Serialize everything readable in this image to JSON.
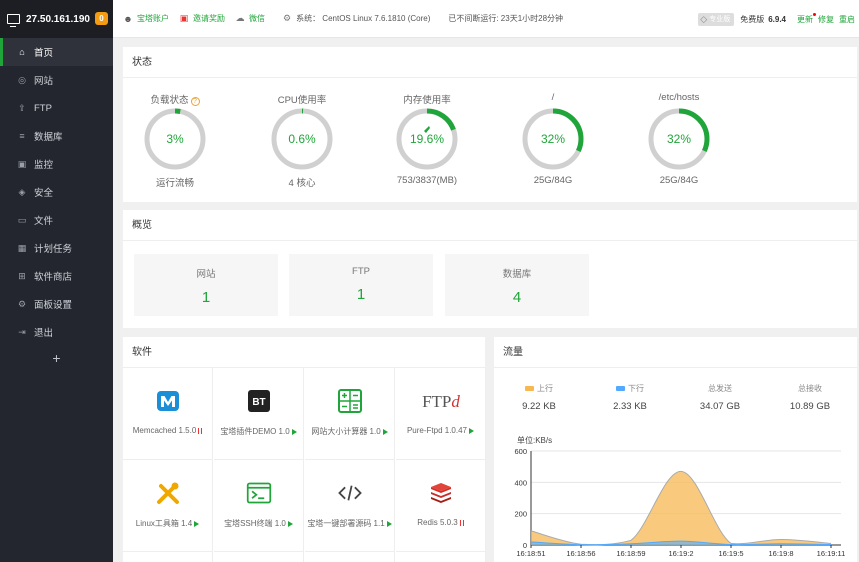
{
  "sidebar": {
    "ip": "27.50.161.190",
    "badge": "0",
    "items": [
      {
        "label": "首页",
        "icon": "home-icon",
        "glyph": "⌂"
      },
      {
        "label": "网站",
        "icon": "globe-icon",
        "glyph": "◎"
      },
      {
        "label": "FTP",
        "icon": "ftp-icon",
        "glyph": "⇪"
      },
      {
        "label": "数据库",
        "icon": "database-icon",
        "glyph": "≡"
      },
      {
        "label": "监控",
        "icon": "monitor-icon",
        "glyph": "▣"
      },
      {
        "label": "安全",
        "icon": "shield-icon",
        "glyph": "◈"
      },
      {
        "label": "文件",
        "icon": "folder-icon",
        "glyph": "▭"
      },
      {
        "label": "计划任务",
        "icon": "calendar-icon",
        "glyph": "▦"
      },
      {
        "label": "软件商店",
        "icon": "apps-icon",
        "glyph": "⊞"
      },
      {
        "label": "面板设置",
        "icon": "gear-icon",
        "glyph": "⚙"
      },
      {
        "label": "退出",
        "icon": "logout-icon",
        "glyph": "⇥"
      }
    ],
    "plus": "+"
  },
  "topbar": {
    "account": "宝塔账户",
    "invite": "邀请奖励",
    "wechat": "微信",
    "system": "系统：  CentOS Linux 7.6.1810 (Core)",
    "uptime": "已不间断运行: 23天1小时28分钟",
    "pro": "专业版",
    "edition": "免费版",
    "version": "6.9.4",
    "update": "更新",
    "repair": "修复",
    "restart": "重启"
  },
  "status": {
    "title": "状态",
    "gauges": [
      {
        "label": "负载状态",
        "value": "3%",
        "percent": 3,
        "sub": "运行流畅",
        "help": "?"
      },
      {
        "label": "CPU使用率",
        "value": "0.6%",
        "percent": 0.6,
        "sub": "4 核心"
      },
      {
        "label": "内存使用率",
        "value": "19.6%",
        "percent": 19.6,
        "sub": "753/3837(MB)"
      },
      {
        "label": "/",
        "value": "32%",
        "percent": 32,
        "sub": "25G/84G"
      },
      {
        "label": "/etc/hosts",
        "value": "32%",
        "percent": 32,
        "sub": "25G/84G"
      }
    ]
  },
  "overview": {
    "title": "概览",
    "cards": [
      {
        "label": "网站",
        "value": "1"
      },
      {
        "label": "FTP",
        "value": "1"
      },
      {
        "label": "数据库",
        "value": "4"
      }
    ]
  },
  "software": {
    "title": "软件",
    "items": [
      {
        "name": "Memcached 1.5.0",
        "icon": "memcached-icon",
        "state": "stopped"
      },
      {
        "name": "宝塔插件DEMO 1.0",
        "icon": "bt-demo-icon",
        "state": "running"
      },
      {
        "name": "网站大小计算器 1.0",
        "icon": "calculator-icon",
        "state": "running"
      },
      {
        "name": "Pure-Ftpd 1.0.47",
        "icon": "ftp-logo-icon",
        "state": "running"
      },
      {
        "name": "Linux工具箱 1.4",
        "icon": "tools-icon",
        "state": "running"
      },
      {
        "name": "宝塔SSH终端 1.0",
        "icon": "terminal-icon",
        "state": "running"
      },
      {
        "name": "宝塔一键部署源码 1.1",
        "icon": "code-icon",
        "state": "running"
      },
      {
        "name": "Redis 5.0.3",
        "icon": "redis-icon",
        "state": "stopped"
      }
    ]
  },
  "traffic": {
    "title": "流量",
    "stats": [
      {
        "label": "上行",
        "value": "9.22 KB",
        "color": "#f7b851"
      },
      {
        "label": "下行",
        "value": "2.33 KB",
        "color": "#52a9ff"
      },
      {
        "label": "总发送",
        "value": "34.07 GB"
      },
      {
        "label": "总接收",
        "value": "10.89 GB"
      }
    ],
    "unit": "单位:KB/s"
  },
  "chart_data": {
    "type": "area",
    "x": [
      "16:18:51",
      "16:18:56",
      "16:18:59",
      "16:19:2",
      "16:19:5",
      "16:19:8",
      "16:19:11"
    ],
    "series": [
      {
        "name": "上行",
        "color": "#f7b851",
        "values": [
          90,
          5,
          30,
          470,
          10,
          35,
          10
        ]
      },
      {
        "name": "下行",
        "color": "#52a9ff",
        "values": [
          20,
          2,
          8,
          25,
          3,
          8,
          3
        ]
      }
    ],
    "ylabel": "单位:KB/s",
    "ylim": [
      0,
      600
    ],
    "yticks": [
      0,
      200,
      400,
      600
    ],
    "grid": true
  },
  "colors": {
    "accent": "#20a53a",
    "sidebar": "#23262e"
  }
}
